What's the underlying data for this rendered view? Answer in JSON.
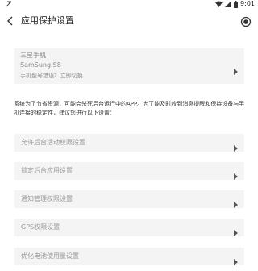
{
  "status_bar": {
    "time": "9:01"
  },
  "toolbar": {
    "title": "应用保护设置"
  },
  "device": {
    "brand": "三星手机",
    "model": "SamSung S8",
    "question": "手机型号错误?",
    "switch_link": "立即切换"
  },
  "description": "系统为了节省资源，可能会杀死后台运行中的APP。为了能及时收到消息提醒和保持设备与手机连接的稳定性，建议您进行以下设置：",
  "settings": [
    {
      "label": "允许后台活动权限设置"
    },
    {
      "label": "锁定后台应用设置"
    },
    {
      "label": "通知管理权限设置"
    },
    {
      "label": "GPS权限设置"
    },
    {
      "label": "优化电池使用量设置"
    }
  ],
  "colors": {
    "card_background": "#f4f4f4",
    "muted_text": "#999999",
    "caret": "#555555"
  },
  "icons": [
    "dnd-icon",
    "wifi-icon",
    "cell-signal-icon",
    "battery-icon",
    "back-arrow-icon",
    "record-icon",
    "caret-right-icon"
  ]
}
